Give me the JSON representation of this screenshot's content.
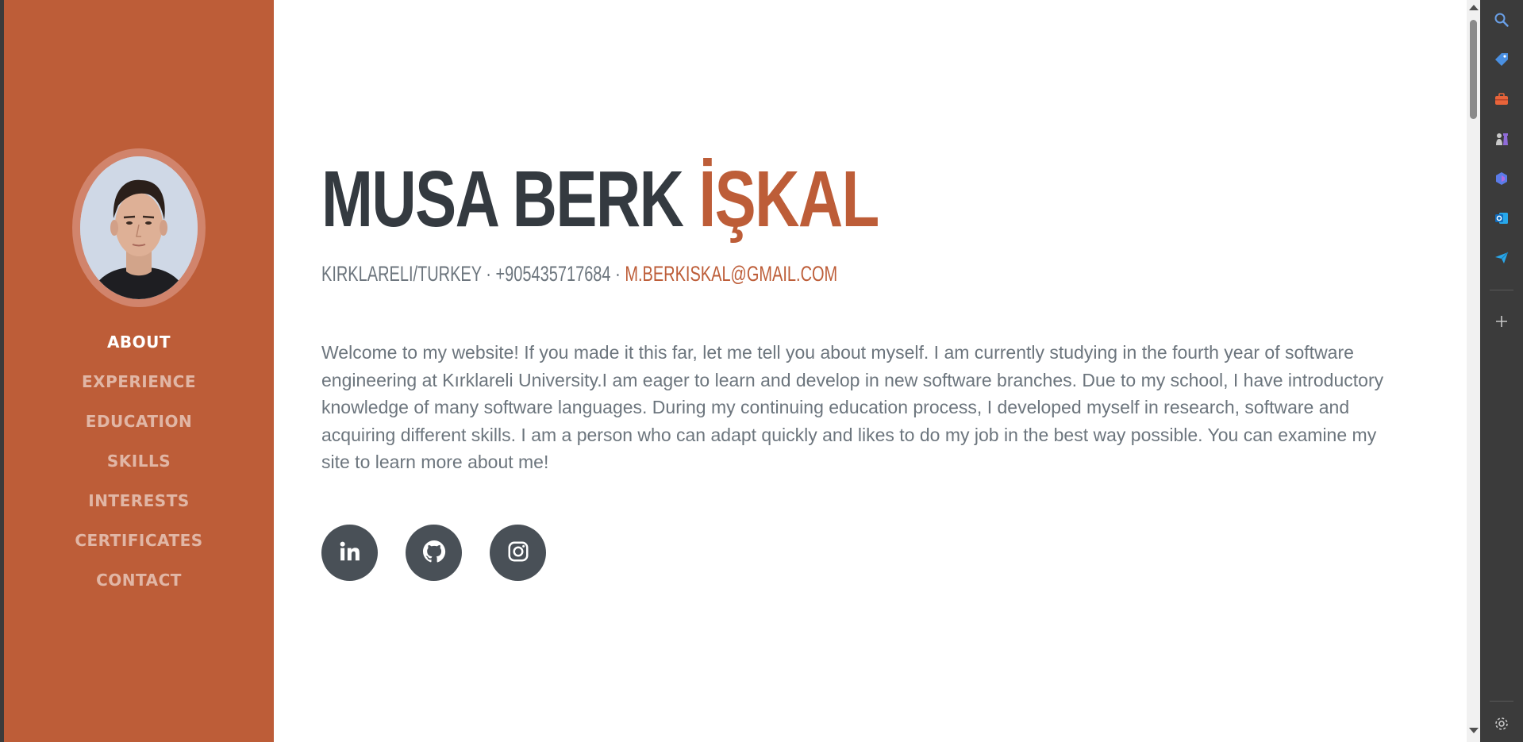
{
  "sidebar": {
    "nav": [
      {
        "label": "ABOUT",
        "active": true
      },
      {
        "label": "EXPERIENCE",
        "active": false
      },
      {
        "label": "EDUCATION",
        "active": false
      },
      {
        "label": "SKILLS",
        "active": false
      },
      {
        "label": "INTERESTS",
        "active": false
      },
      {
        "label": "CERTIFICATES",
        "active": false
      },
      {
        "label": "CONTACT",
        "active": false
      }
    ],
    "bg_color": "#bd5d38"
  },
  "about": {
    "first_name": "MUSA BERK",
    "last_name": "İŞKAL",
    "location": "KIRKLARELI/TURKEY",
    "separator": "·",
    "phone": "+905435717684",
    "email": "M.BERKISKAL@GMAIL.COM",
    "bio": "Welcome to my website! If you made it this far, let me tell you about myself. I am currently studying in the fourth year of software engineering at Kırklareli University.I am eager to learn and develop in new software branches. Due to my school, I have introductory knowledge of many software languages. During my continuing education process, I developed myself in research, software and acquiring different skills. I am a person who can adapt quickly and likes to do my job in the best way possible. You can examine my site to learn more about me!"
  },
  "socials": [
    {
      "icon": "linkedin-icon"
    },
    {
      "icon": "github-icon"
    },
    {
      "icon": "instagram-icon"
    }
  ],
  "right_panel": {
    "icons": [
      "search-icon",
      "tag-icon",
      "briefcase-icon",
      "chess-icon",
      "copilot-icon",
      "outlook-icon",
      "send-icon",
      "add-icon",
      "settings-icon"
    ]
  },
  "colors": {
    "accent": "#bd5d38",
    "heading": "#343a40",
    "muted": "#6c757d",
    "social_bg": "#495057"
  }
}
